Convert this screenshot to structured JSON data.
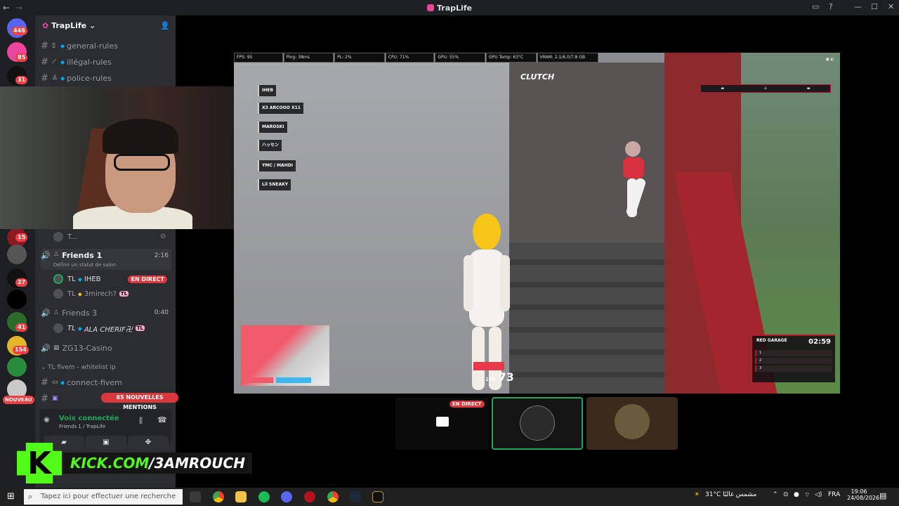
{
  "window": {
    "title": "TrapLife"
  },
  "rail": {
    "badges": [
      "448",
      "85",
      "31",
      "15",
      "27",
      "41",
      "154",
      "NOUVEAU"
    ]
  },
  "server": {
    "name": "TrapLife",
    "channels": [
      {
        "name": "general-rules"
      },
      {
        "name": "illégal-rules"
      },
      {
        "name": "police-rules"
      }
    ],
    "collapsed_user": "T...",
    "voice1": {
      "name": "Friends 1",
      "time": "2:16",
      "status": "Définir un statut de salon"
    },
    "voice1_members": [
      {
        "prefix": "TL",
        "name": "IHEB",
        "live": "EN DIRECT"
      },
      {
        "prefix": "TL",
        "name": "3mirech?",
        "tag": "TL"
      }
    ],
    "voice2": {
      "name": "Friends 3",
      "time": "0:40"
    },
    "voice2_members": [
      {
        "prefix": "TL",
        "name": "ALA CHERIF卍",
        "tag": "TL"
      }
    ],
    "voice3": {
      "name": "ZG13-Casino"
    },
    "category": "TL fivem - whitelist ip",
    "channel_connect": "connect-fivem",
    "mentions": "85 NOUVELLES MENTIONS"
  },
  "voicebar": {
    "status": "Voix connectée",
    "location": "Friends 1 / TrapLife"
  },
  "stream": {
    "hud": [
      "FPS: 95",
      "Ping: 38ms",
      "PL: 2%",
      "CPU: 71%",
      "GPU: 55%",
      "GPU Temp: 63°C",
      "VRAM: 2.1/6.0/7.8 GB"
    ],
    "killfeed": [
      "IHEB",
      "X3 ARCOOO X11",
      "MAROSKI",
      "ハッセン",
      "YMC / MAHDI",
      "Lil SNEAKY"
    ],
    "clutch": "CLUTCH",
    "ammo": "73",
    "ammo_small": "100",
    "garage_title": "RED GARAGE",
    "garage_timer": "02:59",
    "garage_rows": [
      "1",
      "2",
      "3"
    ]
  },
  "participants": {
    "live_badge": "EN DIRECT"
  },
  "kick": {
    "site": "KICK.COM",
    "channel": "/3AMROUCH"
  },
  "taskbar": {
    "search_placeholder": "Tapez ici pour effectuer une recherche",
    "weather": "31°C  مشمس غالبًا",
    "lang": "FRA",
    "time": "19:06",
    "date": "24/08/2026"
  },
  "colors": {
    "discord_bg": "#2b2d31",
    "rail_bg": "#1e1f22",
    "live_red": "#da373c",
    "kick_green": "#53fc18"
  }
}
